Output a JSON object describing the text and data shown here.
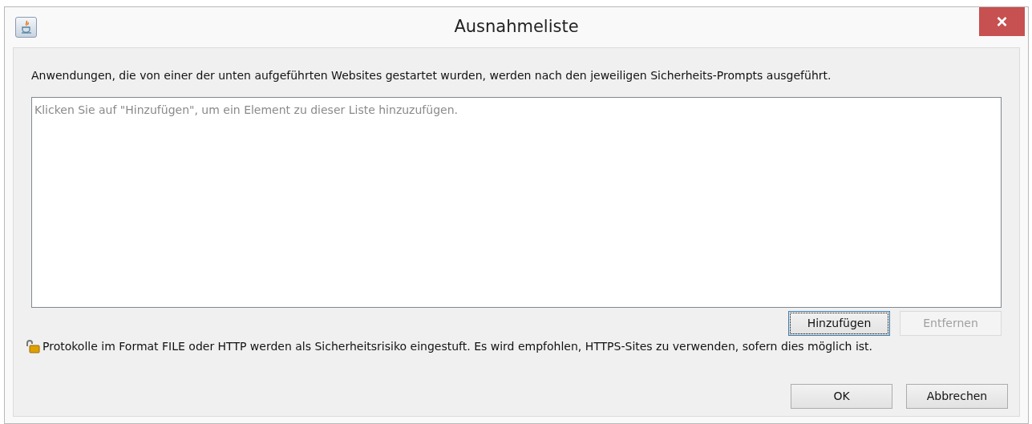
{
  "window": {
    "title": "Ausnahmeliste"
  },
  "description": "Anwendungen, die von einer der unten aufgeführten Websites gestartet wurden, werden nach den jeweiligen Sicherheits-Prompts ausgeführt.",
  "list": {
    "placeholder": "Klicken Sie auf \"Hinzufügen\", um ein Element zu dieser Liste hinzuzufügen."
  },
  "list_buttons": [
    {
      "label": "Hinzufügen",
      "disabled": false,
      "focused": true
    },
    {
      "label": "Entfernen",
      "disabled": true,
      "focused": false
    }
  ],
  "warning": "Protokolle im Format FILE oder HTTP werden als Sicherheitsrisiko eingestuft. Es wird empfohlen, HTTPS-Sites zu verwenden, sofern dies möglich ist.",
  "dialog_buttons": [
    "OK",
    "Abbrechen"
  ]
}
